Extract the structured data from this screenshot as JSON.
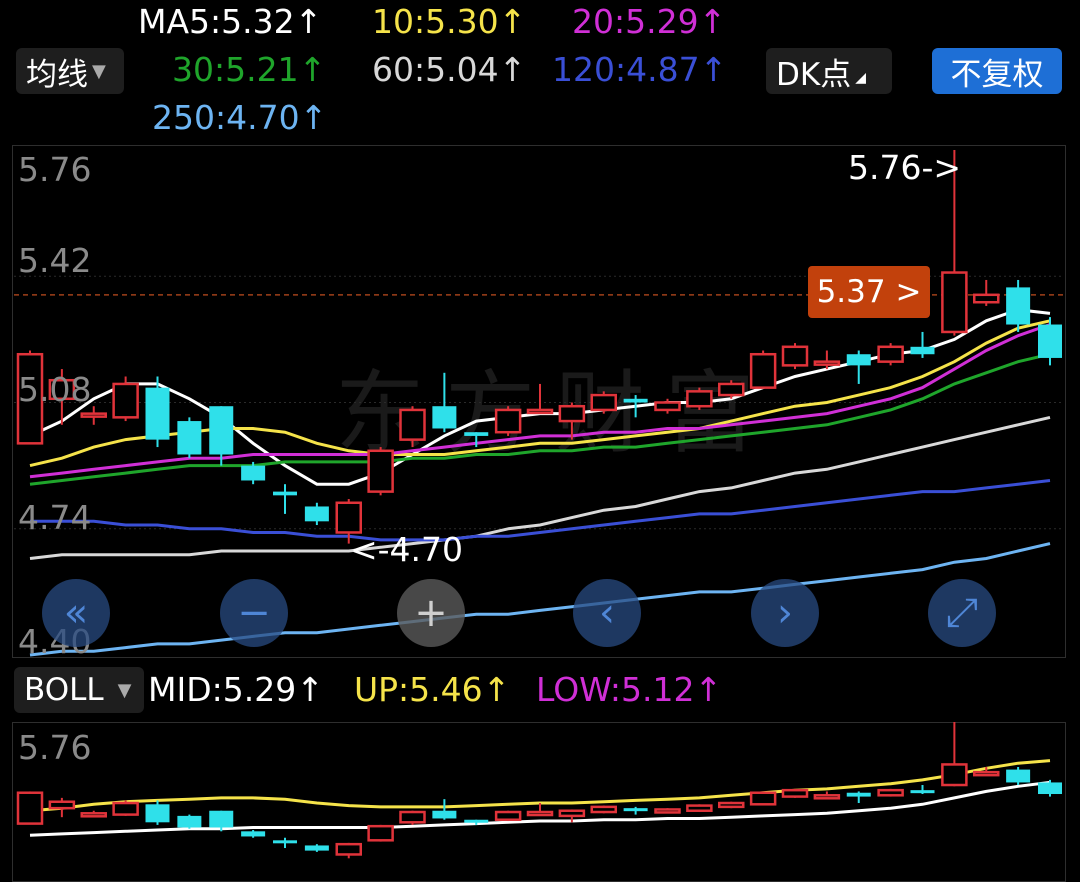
{
  "indicator_select": {
    "label": "均线"
  },
  "ma_values": [
    {
      "text": "MA5:5.32",
      "color": "#ffffff"
    },
    {
      "text": "10:5.30",
      "color": "#f5e34a"
    },
    {
      "text": "20:5.29",
      "color": "#d02fd6"
    },
    {
      "text": "30:5.21",
      "color": "#1fa52b"
    },
    {
      "text": "60:5.04",
      "color": "#d8d8d8"
    },
    {
      "text": "120:4.87",
      "color": "#3a4fd6"
    },
    {
      "text": "250:4.70",
      "color": "#6db4f2"
    }
  ],
  "up_arrow": "↑",
  "dk_button": {
    "label": "DK点"
  },
  "adjust_button": {
    "label": "不复权"
  },
  "main_chart": {
    "y_ticks": [
      "5.76",
      "5.42",
      "5.08",
      "4.74",
      "4.40"
    ],
    "high_label": "5.76->",
    "low_label": "<-4.70",
    "price_tag": "5.37 >",
    "watermark": "东方财富"
  },
  "boll": {
    "select_label": "BOLL",
    "mid": "MID:5.29",
    "up": "UP:5.46",
    "low": "LOW:5.12",
    "y_tick": "5.76"
  },
  "nav": {
    "rewind": "«",
    "zoom_out": "−",
    "zoom_in": "+",
    "prev": "‹",
    "next": "›",
    "fullscreen": "⤢"
  },
  "chart_data": {
    "type": "candlestick",
    "ylim": [
      4.4,
      5.76
    ],
    "candles": [
      {
        "o": 4.97,
        "c": 5.21,
        "h": 5.22,
        "l": 4.97
      },
      {
        "o": 5.09,
        "c": 5.14,
        "h": 5.17,
        "l": 5.02
      },
      {
        "o": 5.05,
        "c": 5.05,
        "h": 5.07,
        "l": 5.02
      },
      {
        "o": 5.04,
        "c": 5.13,
        "h": 5.15,
        "l": 5.03
      },
      {
        "o": 5.12,
        "c": 4.98,
        "h": 5.15,
        "l": 4.96
      },
      {
        "o": 5.03,
        "c": 4.94,
        "h": 5.04,
        "l": 4.93
      },
      {
        "o": 5.07,
        "c": 4.94,
        "h": 5.07,
        "l": 4.91
      },
      {
        "o": 4.91,
        "c": 4.87,
        "h": 4.92,
        "l": 4.86
      },
      {
        "o": 4.84,
        "c": 4.83,
        "h": 4.86,
        "l": 4.78
      },
      {
        "o": 4.8,
        "c": 4.76,
        "h": 4.81,
        "l": 4.75
      },
      {
        "o": 4.73,
        "c": 4.81,
        "h": 4.82,
        "l": 4.7
      },
      {
        "o": 4.84,
        "c": 4.95,
        "h": 4.96,
        "l": 4.83
      },
      {
        "o": 4.98,
        "c": 5.06,
        "h": 5.07,
        "l": 4.96
      },
      {
        "o": 5.07,
        "c": 5.01,
        "h": 5.16,
        "l": 5.0
      },
      {
        "o": 5.0,
        "c": 4.99,
        "h": 5.0,
        "l": 4.96
      },
      {
        "o": 5.0,
        "c": 5.06,
        "h": 5.07,
        "l": 4.99
      },
      {
        "o": 5.06,
        "c": 5.06,
        "h": 5.13,
        "l": 5.05
      },
      {
        "o": 5.03,
        "c": 5.07,
        "h": 5.08,
        "l": 4.98
      },
      {
        "o": 5.06,
        "c": 5.1,
        "h": 5.11,
        "l": 5.05
      },
      {
        "o": 5.09,
        "c": 5.08,
        "h": 5.1,
        "l": 5.04
      },
      {
        "o": 5.06,
        "c": 5.08,
        "h": 5.09,
        "l": 5.05
      },
      {
        "o": 5.07,
        "c": 5.11,
        "h": 5.12,
        "l": 5.06
      },
      {
        "o": 5.1,
        "c": 5.13,
        "h": 5.14,
        "l": 5.09
      },
      {
        "o": 5.12,
        "c": 5.21,
        "h": 5.22,
        "l": 5.12
      },
      {
        "o": 5.18,
        "c": 5.23,
        "h": 5.24,
        "l": 5.17
      },
      {
        "o": 5.19,
        "c": 5.19,
        "h": 5.22,
        "l": 5.17
      },
      {
        "o": 5.21,
        "c": 5.18,
        "h": 5.22,
        "l": 5.13
      },
      {
        "o": 5.19,
        "c": 5.23,
        "h": 5.24,
        "l": 5.18
      },
      {
        "o": 5.23,
        "c": 5.21,
        "h": 5.27,
        "l": 5.2
      },
      {
        "o": 5.27,
        "c": 5.43,
        "h": 5.76,
        "l": 5.26
      },
      {
        "o": 5.35,
        "c": 5.37,
        "h": 5.41,
        "l": 5.34
      },
      {
        "o": 5.39,
        "c": 5.29,
        "h": 5.41,
        "l": 5.27
      },
      {
        "o": 5.29,
        "c": 5.2,
        "h": 5.31,
        "l": 5.18
      }
    ],
    "series": [
      {
        "name": "MA5",
        "color": "#ffffff",
        "values": [
          4.99,
          5.03,
          5.09,
          5.13,
          5.13,
          5.09,
          5.04,
          4.97,
          4.91,
          4.86,
          4.86,
          4.89,
          4.94,
          4.99,
          5.03,
          5.04,
          5.05,
          5.05,
          5.06,
          5.07,
          5.08,
          5.08,
          5.09,
          5.12,
          5.15,
          5.17,
          5.19,
          5.21,
          5.22,
          5.25,
          5.3,
          5.33,
          5.32
        ]
      },
      {
        "name": "MA10",
        "color": "#f5e34a",
        "values": [
          4.91,
          4.93,
          4.96,
          4.98,
          4.99,
          5.0,
          5.01,
          5.01,
          5.0,
          4.97,
          4.95,
          4.94,
          4.94,
          4.94,
          4.95,
          4.96,
          4.97,
          4.97,
          4.98,
          4.99,
          5.0,
          5.01,
          5.03,
          5.05,
          5.07,
          5.08,
          5.1,
          5.12,
          5.15,
          5.19,
          5.24,
          5.28,
          5.3
        ]
      },
      {
        "name": "MA20",
        "color": "#d02fd6",
        "values": [
          4.88,
          4.89,
          4.9,
          4.91,
          4.92,
          4.93,
          4.93,
          4.94,
          4.94,
          4.94,
          4.94,
          4.94,
          4.95,
          4.96,
          4.97,
          4.98,
          4.99,
          4.99,
          5.0,
          5.0,
          5.01,
          5.01,
          5.02,
          5.03,
          5.04,
          5.05,
          5.07,
          5.09,
          5.12,
          5.17,
          5.22,
          5.26,
          5.29
        ]
      },
      {
        "name": "MA30",
        "color": "#1fa52b",
        "values": [
          4.86,
          4.87,
          4.88,
          4.89,
          4.9,
          4.91,
          4.91,
          4.91,
          4.92,
          4.92,
          4.92,
          4.92,
          4.93,
          4.93,
          4.94,
          4.94,
          4.95,
          4.95,
          4.96,
          4.96,
          4.97,
          4.98,
          4.99,
          5.0,
          5.01,
          5.02,
          5.04,
          5.06,
          5.09,
          5.13,
          5.16,
          5.19,
          5.21
        ]
      },
      {
        "name": "MA60",
        "color": "#d8d8d8",
        "values": [
          4.66,
          4.67,
          4.67,
          4.67,
          4.67,
          4.67,
          4.68,
          4.68,
          4.68,
          4.68,
          4.68,
          4.69,
          4.7,
          4.71,
          4.72,
          4.74,
          4.75,
          4.77,
          4.79,
          4.8,
          4.82,
          4.84,
          4.85,
          4.87,
          4.89,
          4.9,
          4.92,
          4.94,
          4.96,
          4.98,
          5.0,
          5.02,
          5.04
        ]
      },
      {
        "name": "MA120",
        "color": "#3a4fd6",
        "values": [
          4.76,
          4.76,
          4.76,
          4.75,
          4.75,
          4.74,
          4.74,
          4.73,
          4.73,
          4.72,
          4.72,
          4.71,
          4.71,
          4.71,
          4.72,
          4.72,
          4.73,
          4.74,
          4.75,
          4.76,
          4.77,
          4.78,
          4.78,
          4.79,
          4.8,
          4.81,
          4.82,
          4.83,
          4.84,
          4.84,
          4.85,
          4.86,
          4.87
        ]
      },
      {
        "name": "MA250",
        "color": "#6db4f2",
        "values": [
          4.4,
          4.41,
          4.41,
          4.42,
          4.43,
          4.43,
          4.44,
          4.45,
          4.46,
          4.46,
          4.47,
          4.48,
          4.49,
          4.5,
          4.51,
          4.51,
          4.52,
          4.53,
          4.54,
          4.55,
          4.56,
          4.57,
          4.57,
          4.58,
          4.59,
          4.6,
          4.61,
          4.62,
          4.63,
          4.65,
          4.66,
          4.68,
          4.7
        ]
      }
    ]
  }
}
